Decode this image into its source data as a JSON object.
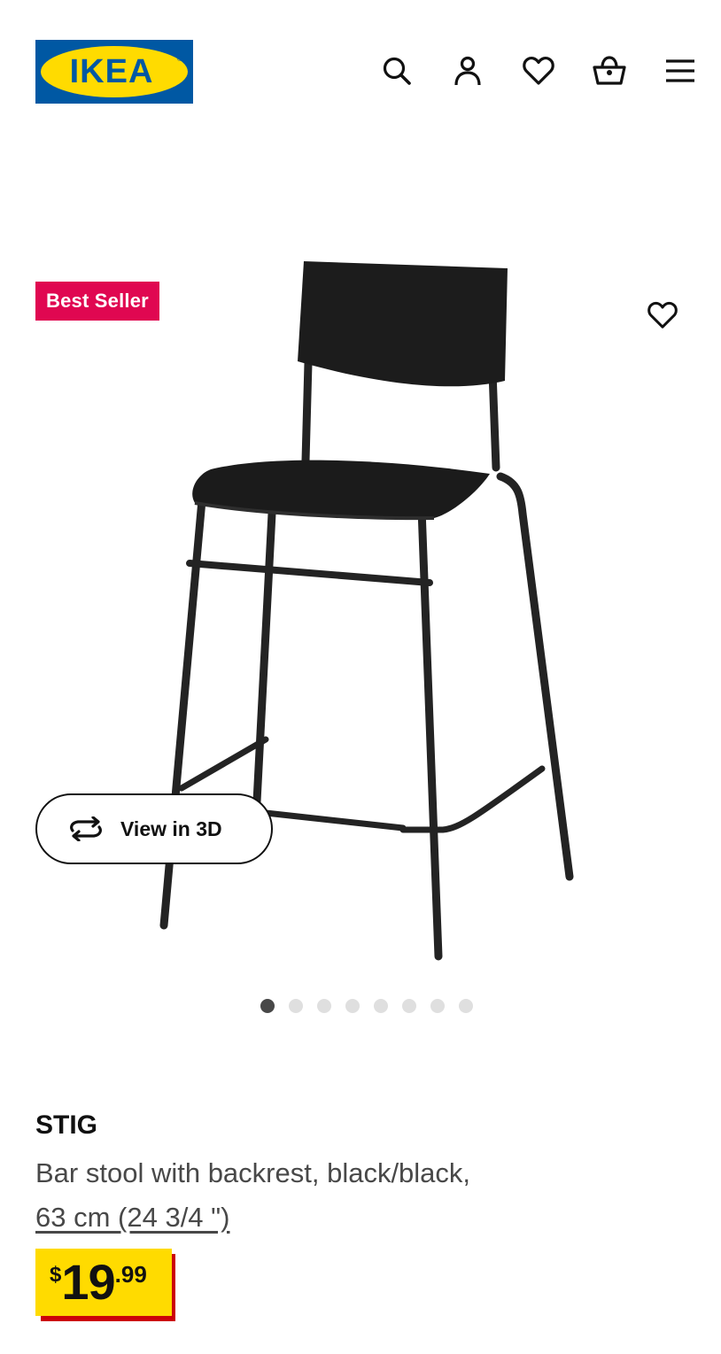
{
  "header": {
    "logo_text": "IKEA",
    "icons": [
      "search-icon",
      "account-icon",
      "heart-icon",
      "basket-icon",
      "menu-icon"
    ]
  },
  "gallery": {
    "badge": "Best Seller",
    "view_3d_label": "View in 3D",
    "slide_count": 8,
    "active_slide": 1
  },
  "product": {
    "name": "STIG",
    "description": "Bar stool with backrest, black/black,",
    "measurement": "63 cm (24 3/4 \")",
    "price": {
      "currency": "$",
      "integer": "19",
      "decimal": ".99"
    }
  },
  "colors": {
    "ikea_blue": "#0058a3",
    "ikea_yellow": "#ffdb00",
    "badge_red": "#e00751",
    "price_shadow_red": "#cc0008"
  }
}
